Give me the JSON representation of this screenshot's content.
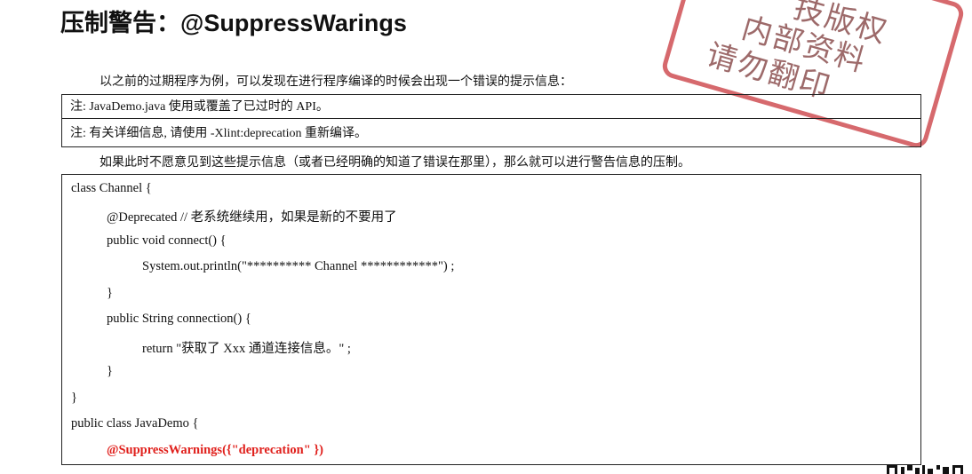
{
  "doc": {
    "title": "压制警告：@SuppressWarings",
    "intro": "以之前的过期程序为例，可以发现在进行程序编译的时候会出现一个错误的提示信息：",
    "note_lines": [
      "注: JavaDemo.java 使用或覆盖了已过时的  API。",
      "注:  有关详细信息, 请使用  -Xlint:deprecation  重新编译。"
    ],
    "explain": "如果此时不愿意见到这些提示信息（或者已经明确的知道了错误在那里），那么就可以进行警告信息的压制。",
    "code": [
      "class Channel {",
      "@Deprecated      //  老系统继续用，如果是新的不要用了",
      "public void connect() {",
      "System.out.println(\"********** Channel ************\") ;",
      "}",
      "public String connection() {",
      "return \"获取了 Xxx 通道连接信息。\" ;",
      "}",
      "}",
      "public class JavaDemo {",
      "@SuppressWarnings({\"deprecation\" })"
    ]
  },
  "stamp": {
    "lines": [
      "技版权",
      "内部资料",
      "请勿翻印"
    ]
  },
  "colors": {
    "highlight": "#e0201c",
    "stamp": "#c8373c"
  }
}
